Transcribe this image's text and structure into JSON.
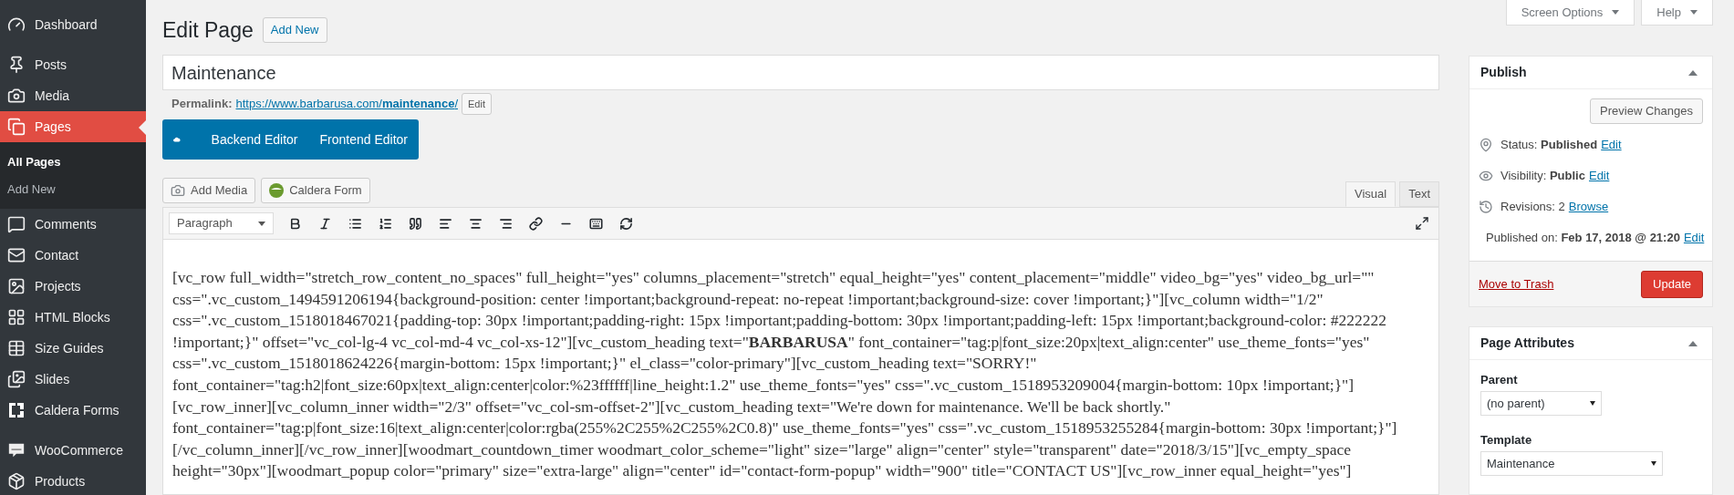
{
  "sidebar": {
    "items": [
      {
        "label": "Dashboard",
        "selected": false
      },
      {
        "label": "Posts",
        "selected": false
      },
      {
        "label": "Media",
        "selected": false
      },
      {
        "label": "Pages",
        "selected": true,
        "children": [
          {
            "label": "All Pages",
            "selected": true
          },
          {
            "label": "Add New",
            "selected": false
          }
        ]
      },
      {
        "label": "Comments",
        "selected": false
      },
      {
        "label": "Contact",
        "selected": false
      },
      {
        "label": "Projects",
        "selected": false
      },
      {
        "label": "HTML Blocks",
        "selected": false
      },
      {
        "label": "Size Guides",
        "selected": false
      },
      {
        "label": "Slides",
        "selected": false
      },
      {
        "label": "Caldera Forms",
        "selected": false
      },
      {
        "label": "WooCommerce",
        "selected": false
      },
      {
        "label": "Products",
        "selected": false
      }
    ]
  },
  "header": {
    "title": "Edit Page",
    "add_new": "Add New",
    "screen_options": "Screen Options",
    "help": "Help"
  },
  "post": {
    "title": "Maintenance",
    "permalink_label": "Permalink:",
    "permalink_base": "https://www.barbarusa.com/",
    "permalink_slug": "maintenance",
    "permalink_end": "/",
    "permalink_edit": "Edit"
  },
  "composer": {
    "buttons": [
      "Backend Editor",
      "Frontend Editor"
    ]
  },
  "media_buttons": [
    "Add Media",
    "Caldera Form"
  ],
  "editor_tabs": [
    {
      "label": "Visual",
      "selected": true
    },
    {
      "label": "Text",
      "selected": false
    }
  ],
  "toolbar": {
    "format": "Paragraph"
  },
  "content_lines": [
    "[vc_row full_width=\"stretch_row_content_no_spaces\" full_height=\"yes\" columns_placement=\"stretch\" equal_height=\"yes\" content_placement=\"middle\" video_bg=\"yes\" video_bg_url=\"\"",
    "css=\".vc_custom_1494591206194{background-position: center !important;background-repeat: no-repeat !important;background-size: cover !important;}\"][vc_column width=\"1/2\"",
    "css=\".vc_custom_1518018467021{padding-top: 30px !important;padding-right: 15px !important;padding-bottom: 30px !important;padding-left: 15px !important;background-color: #222222",
    "!important;}\" offset=\"vc_col-lg-4 vc_col-md-4 vc_col-xs-12\"][vc_custom_heading text=\"**BARBARUSA**\" font_container=\"tag:p|font_size:20px|text_align:center\" use_theme_fonts=\"yes\"",
    "css=\".vc_custom_1518018624226{margin-bottom: 15px !important;}\" el_class=\"color-primary\"][vc_custom_heading text=\"SORRY!\"",
    "font_container=\"tag:h2|font_size:60px|text_align:center|color:%23ffffff|line_height:1.2\" use_theme_fonts=\"yes\" css=\".vc_custom_1518953209004{margin-bottom: 10px !important;}\"]",
    "[vc_row_inner][vc_column_inner width=\"2/3\" offset=\"vc_col-sm-offset-2\"][vc_custom_heading text=\"We're down for maintenance. We'll be back shortly.\"",
    "font_container=\"tag:p|font_size:16|text_align:center|color:rgba(255%2C255%2C255%2C0.8)\" use_theme_fonts=\"yes\" css=\".vc_custom_1518953255284{margin-bottom: 30px !important;}\"]",
    "[/vc_column_inner][/vc_row_inner][woodmart_countdown_timer woodmart_color_scheme=\"light\" size=\"large\" align=\"center\" style=\"transparent\" date=\"2018/3/15\"][vc_empty_space",
    "height=\"30px\"][woodmart_popup color=\"primary\" size=\"extra-large\" align=\"center\" id=\"contact-form-popup\" width=\"900\" title=\"CONTACT US\"][vc_row_inner equal_height=\"yes\"]"
  ],
  "publish": {
    "title": "Publish",
    "expanded": true,
    "preview": "Preview Changes",
    "rows": [
      {
        "kind": "status",
        "text": "Status: **Published**",
        "link": "Edit"
      },
      {
        "kind": "visibility",
        "text": "Visibility: **Public**",
        "link": "Edit"
      },
      {
        "kind": "revisions",
        "text": "Revisions: 2",
        "link": "Browse"
      },
      {
        "kind": "date",
        "text": "Published on: **Feb 17, 2018 @ 21:20**",
        "link": "Edit"
      }
    ],
    "trash": "Move to Trash",
    "update": "Update"
  },
  "page_attributes": {
    "title": "Page Attributes",
    "expanded": true,
    "parent_label": "Parent",
    "parent_value": "(no parent)",
    "template_label": "Template",
    "template_value": "Maintenance"
  }
}
